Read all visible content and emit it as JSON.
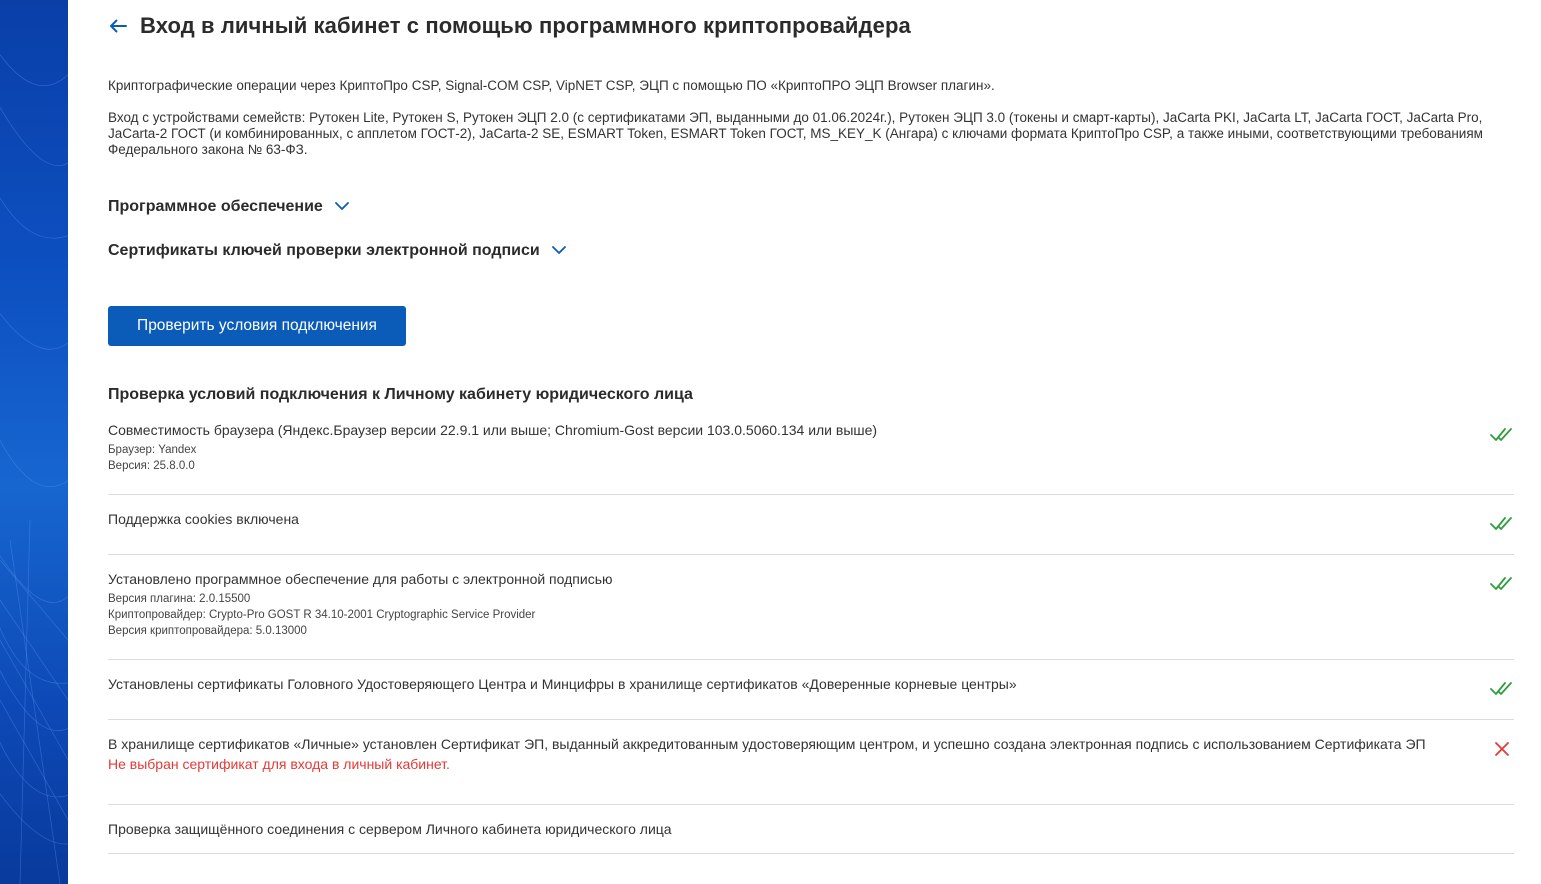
{
  "header": {
    "title": "Вход в личный кабинет с помощью программного криптопровайдера"
  },
  "intro": {
    "paragraph1": "Криптографические операции через КриптоПро CSP, Signal-COM CSP, VipNET CSP, ЭЦП с помощью ПО «КриптоПРО ЭЦП Browser плагин».",
    "paragraph2": "Вход с устройствами семейств: Рутокен Lite, Рутокен S, Рутокен ЭЦП 2.0 (с сертификатами ЭП, выданными до 01.06.2024г.), Рутокен ЭЦП 3.0 (токены и смарт-карты), JaCarta PKI, JaCarta LT, JaCarta ГОСТ, JaCarta Pro, JaCarta-2 ГОСТ (и комбинированных, с апплетом ГОСТ-2), JaCarta-2 SE, ESMART Token, ESMART Token ГОСТ, MS_KEY_K (Ангара) с ключами формата КриптоПро CSP, а также иными, соответствующими требованиям Федерального закона № 63-ФЗ."
  },
  "accordions": {
    "software": "Программное обеспечение",
    "certificates": "Сертификаты ключей проверки электронной подписи"
  },
  "check_button": {
    "label": "Проверить условия подключения"
  },
  "checks": {
    "title": "Проверка условий подключения к Личному кабинету юридического лица",
    "items": [
      {
        "title": "Совместимость браузера (Яндекс.Браузер версии 22.9.1 или выше; Chromium-Gost версии 103.0.5060.134 или выше)",
        "details": [
          "Браузер: Yandex",
          "Версия: 25.8.0.0"
        ],
        "status": "ok"
      },
      {
        "title": "Поддержка cookies включена",
        "details": [],
        "status": "ok"
      },
      {
        "title": "Установлено программное обеспечение для работы с электронной подписью",
        "details": [
          "Версия плагина: 2.0.15500",
          "Криптопровайдер: Crypto-Pro GOST R 34.10-2001 Cryptographic Service Provider",
          "Версия криптопровайдера: 5.0.13000"
        ],
        "status": "ok"
      },
      {
        "title": "Установлены сертификаты Головного Удостоверяющего Центра и Минцифры в хранилище сертификатов «Доверенные корневые центры»",
        "details": [],
        "status": "ok"
      },
      {
        "title": "В хранилище сертификатов «Личные» установлен Сертификат ЭП, выданный аккредитованным удостоверяющим центром, и успешно создана электронная подпись с использованием Сертификата ЭП",
        "details": [],
        "error": "Не выбран сертификат для входа в личный кабинет.",
        "status": "error"
      },
      {
        "title": "Проверка защищённого соединения с сервером Личного кабинета юридического лица",
        "details": [],
        "status": "pending"
      }
    ]
  },
  "colors": {
    "primary": "#0b5cb8",
    "ok": "#2e9e3e",
    "error": "#e53935",
    "side_band": "#0d4fc0"
  },
  "icons": {
    "back": "arrow-left-icon",
    "chevron": "chevron-down-icon",
    "ok": "double-check-icon",
    "error": "close-icon"
  }
}
